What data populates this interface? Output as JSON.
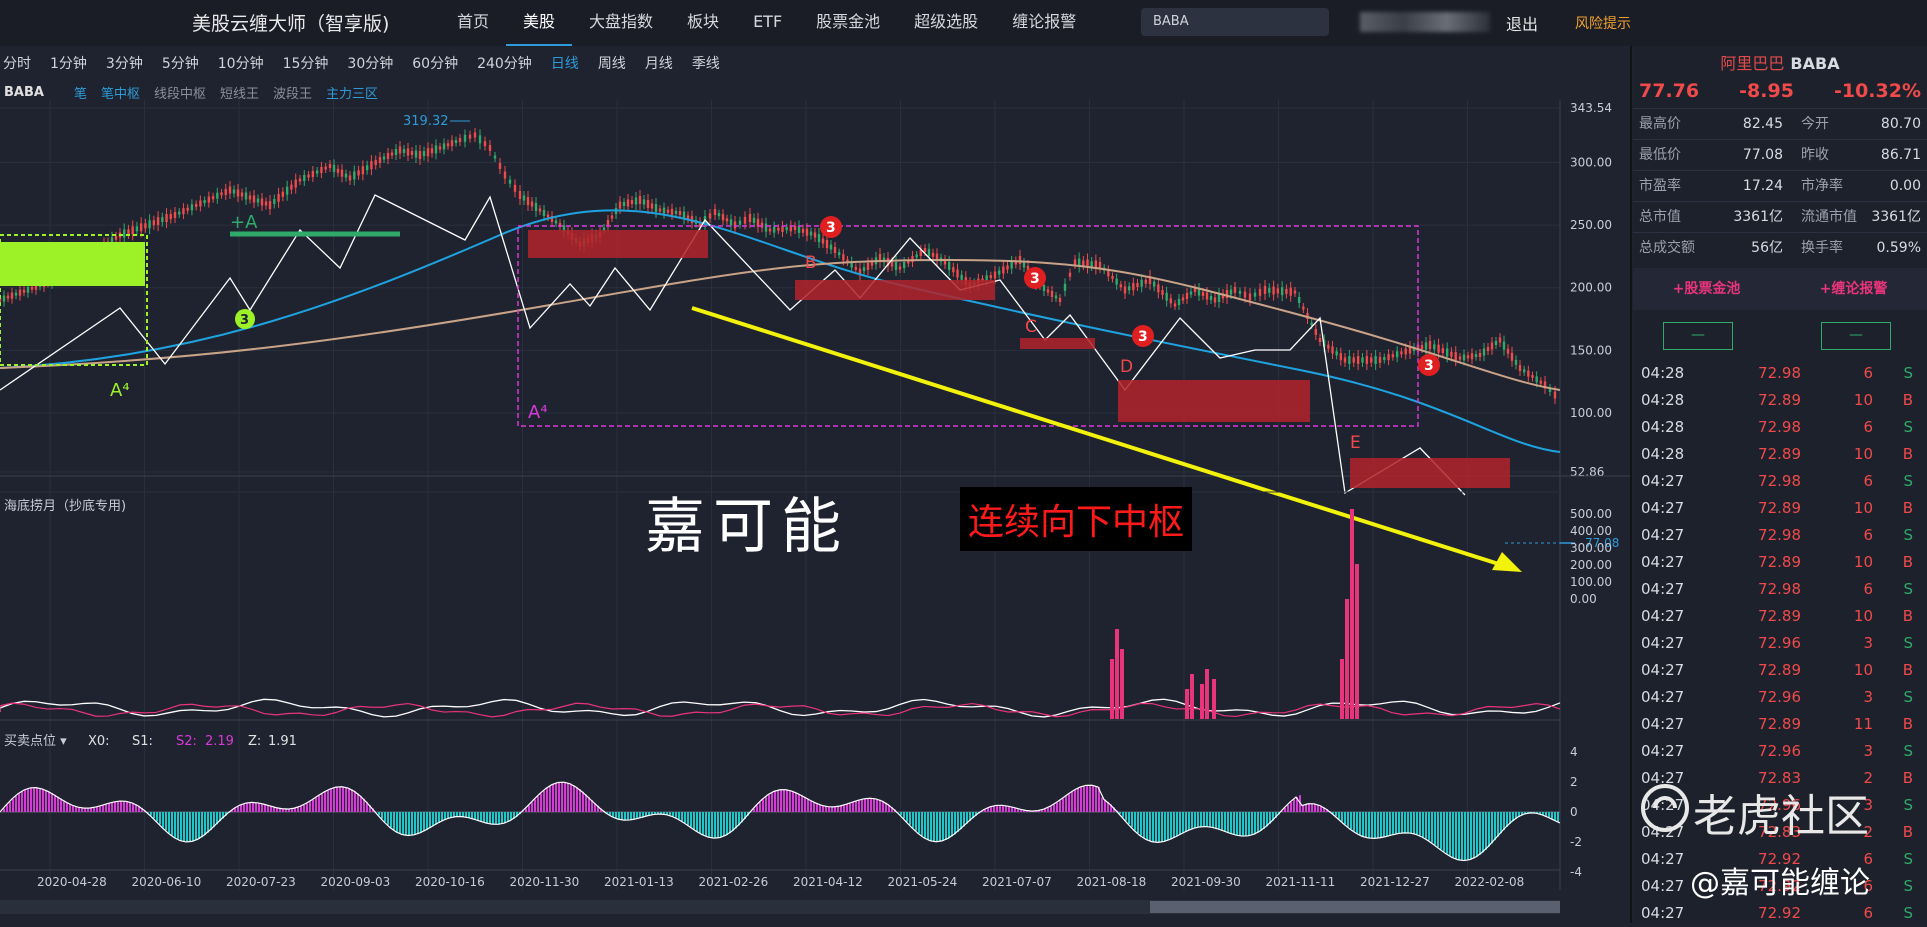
{
  "app": {
    "title": "美股云缠大师（智享版)"
  },
  "nav": [
    "首页",
    "美股",
    "大盘指数",
    "板块",
    "ETF",
    "股票金池",
    "超级选股",
    "缠论报警"
  ],
  "nav_active": 1,
  "search": {
    "value": "BABA"
  },
  "logout": "退出",
  "risk": "风险提示",
  "timeframes": [
    "分时",
    "1分钟",
    "3分钟",
    "5分钟",
    "10分钟",
    "15分钟",
    "30分钟",
    "60分钟",
    "240分钟",
    "日线",
    "周线",
    "月线",
    "季线"
  ],
  "timeframe_active": 9,
  "legend": {
    "symbol": "BABA",
    "indicators": [
      {
        "label": "笔",
        "color": "#2e9bd6"
      },
      {
        "label": "笔中枢",
        "color": "#2e9bd6"
      },
      {
        "label": "线段中枢",
        "color": "#8a8f9c"
      },
      {
        "label": "短线王",
        "color": "#8a8f9c"
      },
      {
        "label": "波段王",
        "color": "#8a8f9c"
      },
      {
        "label": "主力三区",
        "color": "#2e9bd6"
      }
    ]
  },
  "price_axis": [
    "343.54",
    "300.00",
    "250.00",
    "200.00",
    "150.00",
    "100.00",
    "52.86"
  ],
  "current_price_label": "77.08",
  "peak_label": "319.32",
  "annotations": {
    "a_plus": "+A",
    "b": "B",
    "c": "C",
    "d": "D",
    "e": "E",
    "a4_left": "A⁴",
    "a4_mid": "A⁴",
    "buy3": "3",
    "sell3": "3"
  },
  "sub1": {
    "title": "海底捞月（抄底专用)",
    "axis": [
      "500.00",
      "400.00",
      "300.00",
      "200.00",
      "100.00",
      "0.00"
    ]
  },
  "sub2": {
    "title": "买卖点位",
    "x0_label": "X0:",
    "s1_label": "S1:",
    "s2_label": "S2:",
    "s2_value": "2.19",
    "z_label": "Z:",
    "z_value": "1.91",
    "axis": [
      "4",
      "2",
      "0",
      "-2",
      "-4"
    ]
  },
  "x_dates": [
    "2020-04-28",
    "2020-06-10",
    "2020-07-23",
    "2020-09-03",
    "2020-10-16",
    "2020-11-30",
    "2021-01-13",
    "2021-02-26",
    "2021-04-12",
    "2021-05-24",
    "2021-07-07",
    "2021-08-18",
    "2021-09-30",
    "2021-11-11",
    "2021-12-27",
    "2022-02-08"
  ],
  "quote": {
    "name": "阿里巴巴",
    "code": "BABA",
    "price": "77.76",
    "change": "-8.95",
    "pct": "-10.32%",
    "stats": [
      {
        "k": "最高价",
        "v": "82.45",
        "k2": "今开",
        "v2": "80.70"
      },
      {
        "k": "最低价",
        "v": "77.08",
        "k2": "昨收",
        "v2": "86.71"
      },
      {
        "k": "市盈率",
        "v": "17.24",
        "k2": "市净率",
        "v2": "0.00"
      },
      {
        "k": "总市值",
        "v": "3361亿",
        "k2": "流通市值",
        "v2": "3361亿"
      },
      {
        "k": "总成交额",
        "v": "56亿",
        "k2": "换手率",
        "v2": "0.59%"
      }
    ],
    "add_pool": "+股票金池",
    "add_alert": "+缠论报警",
    "minus": "—"
  },
  "trades": [
    {
      "t": "04:28",
      "p": "72.98",
      "q": "6",
      "s": "S"
    },
    {
      "t": "04:28",
      "p": "72.89",
      "q": "10",
      "s": "B"
    },
    {
      "t": "04:28",
      "p": "72.98",
      "q": "6",
      "s": "S"
    },
    {
      "t": "04:28",
      "p": "72.89",
      "q": "10",
      "s": "B"
    },
    {
      "t": "04:27",
      "p": "72.98",
      "q": "6",
      "s": "S"
    },
    {
      "t": "04:27",
      "p": "72.89",
      "q": "10",
      "s": "B"
    },
    {
      "t": "04:27",
      "p": "72.98",
      "q": "6",
      "s": "S"
    },
    {
      "t": "04:27",
      "p": "72.89",
      "q": "10",
      "s": "B"
    },
    {
      "t": "04:27",
      "p": "72.98",
      "q": "6",
      "s": "S"
    },
    {
      "t": "04:27",
      "p": "72.89",
      "q": "10",
      "s": "B"
    },
    {
      "t": "04:27",
      "p": "72.96",
      "q": "3",
      "s": "S"
    },
    {
      "t": "04:27",
      "p": "72.89",
      "q": "10",
      "s": "B"
    },
    {
      "t": "04:27",
      "p": "72.96",
      "q": "3",
      "s": "S"
    },
    {
      "t": "04:27",
      "p": "72.89",
      "q": "11",
      "s": "B"
    },
    {
      "t": "04:27",
      "p": "72.96",
      "q": "3",
      "s": "S"
    },
    {
      "t": "04:27",
      "p": "72.83",
      "q": "2",
      "s": "B"
    },
    {
      "t": "04:27",
      "p": "72.96",
      "q": "3",
      "s": "S"
    },
    {
      "t": "04:27",
      "p": "72.83",
      "q": "2",
      "s": "B"
    },
    {
      "t": "04:27",
      "p": "72.92",
      "q": "6",
      "s": "S"
    },
    {
      "t": "04:27",
      "p": "72.92",
      "q": "6",
      "s": "S"
    },
    {
      "t": "04:27",
      "p": "72.92",
      "q": "6",
      "s": "S"
    }
  ],
  "watermark": {
    "author": "嘉可能",
    "slogan": "连续向下中枢",
    "community": "老虎社区",
    "handle": "@嘉可能缠论"
  },
  "colors": {
    "up": "#f04a4a",
    "down": "#2faa6a",
    "accent": "#2e9bd6",
    "pivot_fill": "#b3232a",
    "pivot_box": "#d63bd6",
    "ma_blue": "#1ea3e0",
    "ma_tan": "#c9a387"
  }
}
